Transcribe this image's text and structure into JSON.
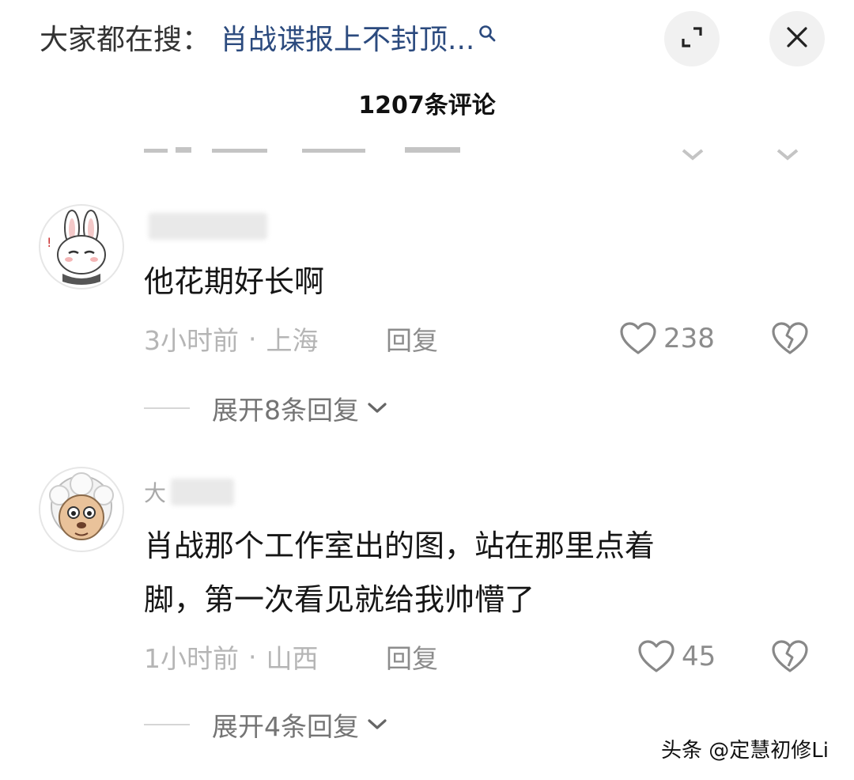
{
  "header": {
    "search_prefix": "大家都在搜：",
    "search_query": "肖战谍报上不封顶..."
  },
  "comment_count": "1207条评论",
  "comments": [
    {
      "username_visible": "",
      "text": "他花期好长啊",
      "time": "3小时前",
      "location": "上海",
      "reply_label": "回复",
      "likes": "238",
      "expand_label": "展开8条回复"
    },
    {
      "username_visible": "大",
      "text_line1": "肖战那个工作室出的图，站在那里点着",
      "text_line2": "脚，第一次看见就给我帅懵了",
      "time": "1小时前",
      "location": "山西",
      "reply_label": "回复",
      "likes": "45",
      "expand_label": "展开4条回复"
    }
  ],
  "meta_separator": "·",
  "watermark": "头条 @定慧初修Li",
  "icons": {
    "search": "search-icon",
    "expand": "expand-icon",
    "close": "close-icon",
    "like": "heart-icon",
    "dislike": "broken-heart-icon",
    "chevron": "chevron-down-icon"
  },
  "colors": {
    "query": "#2b4a7e",
    "meta": "#b5b5b5",
    "button_bg": "#f1f1f1"
  }
}
